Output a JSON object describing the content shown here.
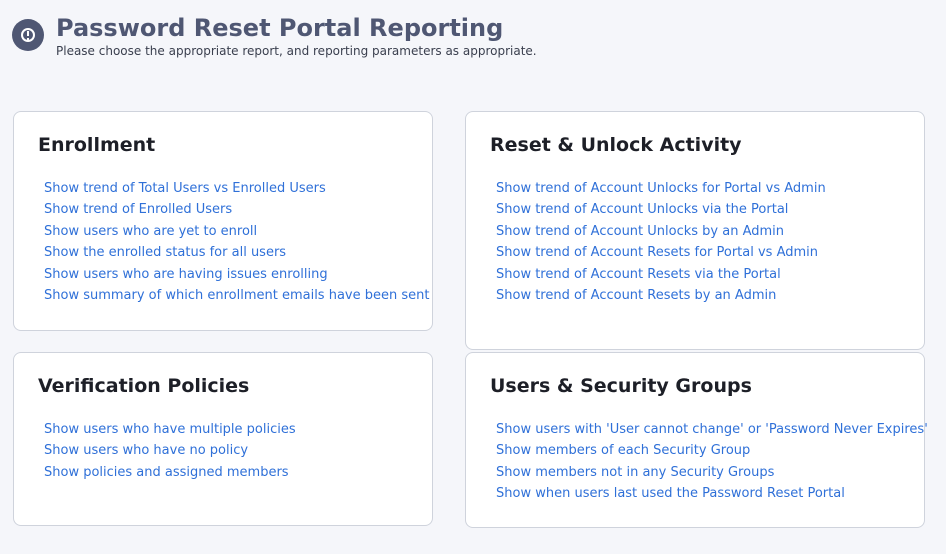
{
  "header": {
    "title": "Password Reset Portal Reporting",
    "subtitle": "Please choose the appropriate report, and reporting parameters as appropriate.",
    "icon": "info-circle-icon",
    "icon_color": "#4f5773"
  },
  "colors": {
    "link": "#2f70d8",
    "background": "#f5f6fa",
    "card_border": "#cfd3dc"
  },
  "cards": {
    "enrollment": {
      "title": "Enrollment",
      "links": [
        "Show trend of Total Users vs Enrolled Users",
        "Show trend of Enrolled Users",
        "Show users who are yet to enroll",
        "Show the enrolled status for all users",
        "Show users who are having issues enrolling",
        "Show summary of which enrollment emails have been sent"
      ]
    },
    "reset_unlock": {
      "title": "Reset & Unlock Activity",
      "links": [
        "Show trend of Account Unlocks for Portal vs Admin",
        "Show trend of Account Unlocks via the Portal",
        "Show trend of Account Unlocks by an Admin",
        "Show trend of Account Resets for Portal vs Admin",
        "Show trend of Account Resets via the Portal",
        "Show trend of Account Resets by an Admin"
      ]
    },
    "verification": {
      "title": "Verification Policies",
      "links": [
        "Show users who have multiple policies",
        "Show users who have no policy",
        "Show policies and assigned members"
      ]
    },
    "security_groups": {
      "title": "Users & Security Groups",
      "links": [
        "Show users with 'User cannot change' or 'Password Never Expires'",
        "Show members of each Security Group",
        "Show members not in any Security Groups",
        "Show when users last used the Password Reset Portal"
      ]
    }
  }
}
